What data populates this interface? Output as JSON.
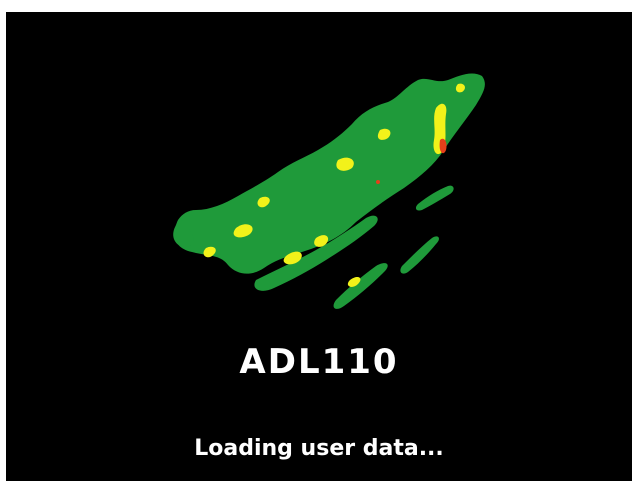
{
  "splash": {
    "product_name": "ADL110",
    "status": "Loading user data..."
  },
  "colors": {
    "background": "#000000",
    "frame": "#ffffff",
    "text": "#ffffff",
    "radar_green": "#1f9a3a",
    "radar_yellow": "#f2f21a",
    "radar_red": "#e4401a"
  },
  "icons": {
    "logo": "weather-radar-image"
  }
}
